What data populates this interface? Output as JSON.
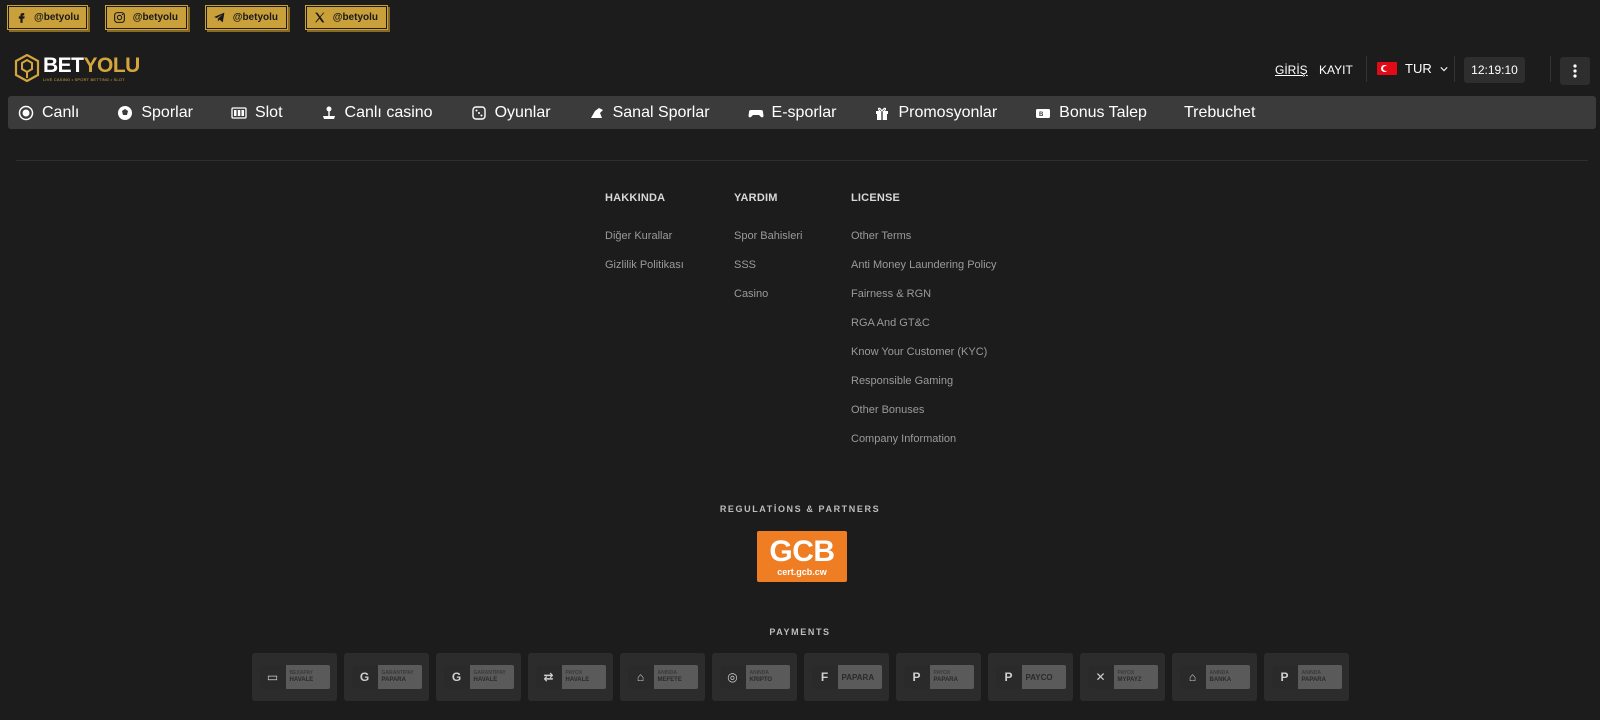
{
  "social": [
    {
      "icon": "facebook-icon",
      "handle": "@betyolu"
    },
    {
      "icon": "instagram-icon",
      "handle": "@betyolu"
    },
    {
      "icon": "telegram-icon",
      "handle": "@betyolu"
    },
    {
      "icon": "x-icon",
      "handle": "@betyolu"
    }
  ],
  "brand": {
    "name_1": "BET",
    "name_2": "YOLU",
    "tagline": "LIVE CASINO • SPORT BETTING • SLOT",
    "accent": "#d4a53c"
  },
  "header": {
    "login": "GİRİŞ",
    "register": "KAYIT",
    "language": "TUR",
    "clock": "12:19:10"
  },
  "nav": [
    {
      "label": "Canlı",
      "icon": "live-icon"
    },
    {
      "label": "Sporlar",
      "icon": "soccer-ball-icon"
    },
    {
      "label": "Slot",
      "icon": "slot-machine-icon"
    },
    {
      "label": "Canlı casino",
      "icon": "joystick-icon"
    },
    {
      "label": "Oyunlar",
      "icon": "dice-icon"
    },
    {
      "label": "Sanal Sporlar",
      "icon": "virtual-sports-icon"
    },
    {
      "label": "E-sporlar",
      "icon": "gamepad-icon"
    },
    {
      "label": "Promosyonlar",
      "icon": "gift-icon"
    },
    {
      "label": "Bonus Talep",
      "icon": "bonus-ticket-icon"
    },
    {
      "label": "Trebuchet",
      "icon": ""
    }
  ],
  "footer": {
    "col1": {
      "title": "HAKKINDA",
      "links": [
        "Diğer Kurallar",
        "Gizlilik Politikası"
      ]
    },
    "col2": {
      "title": "YARDIM",
      "links": [
        "Spor Bahisleri",
        "SSS",
        "Casino"
      ]
    },
    "col3": {
      "title": "LICENSE",
      "links": [
        "Other Terms",
        "Anti Money Laundering Policy",
        "Fairness & RGN",
        "RGA And GT&C",
        "Know Your Customer (KYC)",
        "Responsible Gaming",
        "Other Bonuses",
        "Company Information"
      ]
    },
    "regulations_title": "REGULATİONS & PARTNERS",
    "gcb": {
      "big": "GCB",
      "small": "cert.gcb.cw"
    },
    "payments_title": "PAYMENTS"
  },
  "payments": [
    {
      "ico": "▭",
      "l1": "BEXAPAY",
      "l2": "HAVALE"
    },
    {
      "ico": "G",
      "l1": "GARANTIPAY",
      "l2": "PAPARA"
    },
    {
      "ico": "G",
      "l1": "GARANTIPAY",
      "l2": "HAVALE"
    },
    {
      "ico": "⇄",
      "l1": "PAYOX",
      "l2": "HAVALE"
    },
    {
      "ico": "⌂",
      "l1": "ANINDA",
      "l2": "MEFETE"
    },
    {
      "ico": "◎",
      "l1": "ANINDA",
      "l2": "KRIPTO"
    },
    {
      "ico": "F",
      "l1": "",
      "l2": "PAPARA"
    },
    {
      "ico": "P",
      "l1": "PAYOX",
      "l2": "PAPARA"
    },
    {
      "ico": "P",
      "l1": "",
      "l2": "PAYCO"
    },
    {
      "ico": "✕",
      "l1": "PAYOX",
      "l2": "MYPAYZ"
    },
    {
      "ico": "⌂",
      "l1": "ANINDA",
      "l2": "BANKA"
    },
    {
      "ico": "P",
      "l1": "ANINDA",
      "l2": "PAPARA"
    }
  ]
}
